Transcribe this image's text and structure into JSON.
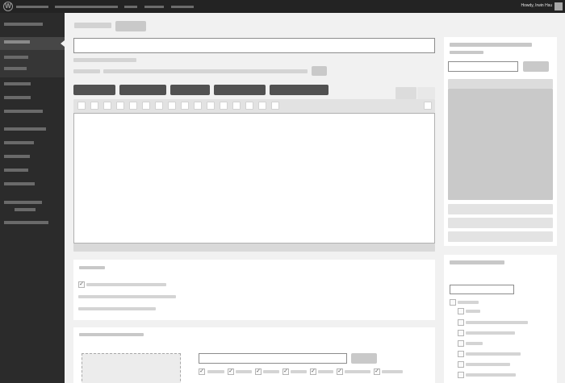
{
  "admin_bar": {
    "greeting": "Howdy, Irwin Hsu"
  },
  "icons": {
    "wp_logo": "wordpress-logo-icon",
    "avatar": "user-avatar-icon",
    "check": "checkmark-icon"
  },
  "colors": {
    "admin_bar_bg": "#232323",
    "sidebar_bg": "#2b2b2b",
    "sidebar_current": "#474747",
    "page_bg": "#f1f1f1",
    "panel_bg": "#ffffff"
  }
}
